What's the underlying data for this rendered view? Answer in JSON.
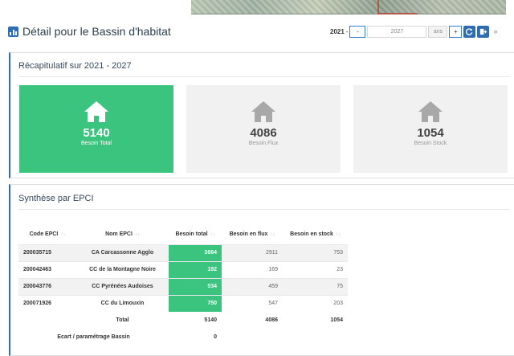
{
  "header": {
    "title": "Détail pour le Bassin d'habitat",
    "year_start": "2021",
    "minus_label": "-",
    "year_end": "2027",
    "unit": "ans",
    "plus_label": "+",
    "refresh_icon": "refresh-icon",
    "export_icon": "export-icon",
    "more_label": "»"
  },
  "recap": {
    "title": "Récapitulatif sur 2021 - 2027",
    "cards": [
      {
        "value": "5140",
        "label": "Besoin Total",
        "icon": "home-icon",
        "active": true
      },
      {
        "value": "4086",
        "label": "Besoin Flux",
        "icon": "home-icon",
        "active": false
      },
      {
        "value": "1054",
        "label": "Besoin Stock",
        "icon": "home-icon",
        "active": false
      }
    ]
  },
  "synthese": {
    "title": "Synthèse par EPCI",
    "columns": [
      "Code EPCI",
      "Nom EPCI",
      "Besoin total",
      "Besoin en flux",
      "Besoin en stock"
    ],
    "rows": [
      {
        "code": "200035715",
        "name": "CA Carcassonne Agglo",
        "total": "3664",
        "flux": "2911",
        "stock": "753"
      },
      {
        "code": "200042463",
        "name": "CC de la Montagne Noire",
        "total": "192",
        "flux": "169",
        "stock": "23"
      },
      {
        "code": "200043776",
        "name": "CC Pyrénées Audoises",
        "total": "534",
        "flux": "459",
        "stock": "75"
      },
      {
        "code": "200071926",
        "name": "CC du Limouxin",
        "total": "750",
        "flux": "547",
        "stock": "203"
      }
    ],
    "total_row": {
      "label": "Total",
      "total": "5140",
      "flux": "4086",
      "stock": "1054"
    },
    "ecart_row": {
      "label": "Ecart / paramétrage Bassin",
      "total": "0"
    }
  },
  "colors": {
    "accent": "#3ac47d",
    "primary": "#2f6db2"
  }
}
